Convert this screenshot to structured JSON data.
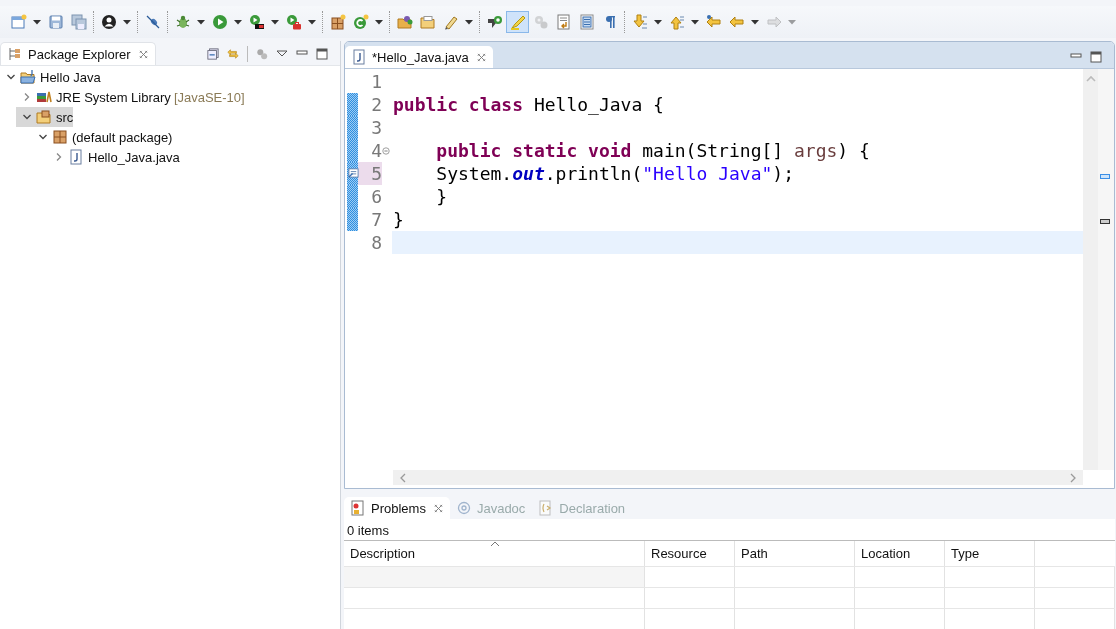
{
  "toolbar": {
    "groups": [
      {
        "items": [
          {
            "kind": "new",
            "dropdown": true,
            "selected": false,
            "disabled": false
          },
          {
            "kind": "save",
            "dropdown": false,
            "selected": false,
            "disabled": false
          },
          {
            "kind": "save-all",
            "dropdown": false,
            "selected": false,
            "disabled": false
          }
        ]
      },
      {
        "items": [
          {
            "kind": "person",
            "dropdown": true,
            "selected": false,
            "disabled": false
          }
        ]
      },
      {
        "items": [
          {
            "kind": "pin",
            "dropdown": false,
            "selected": false,
            "disabled": false
          }
        ]
      },
      {
        "items": [
          {
            "kind": "bug",
            "dropdown": true,
            "selected": false,
            "disabled": false
          },
          {
            "kind": "run",
            "dropdown": true,
            "selected": false,
            "disabled": false
          },
          {
            "kind": "coverage",
            "dropdown": true,
            "selected": false,
            "disabled": false
          },
          {
            "kind": "external",
            "dropdown": true,
            "selected": false,
            "disabled": false
          }
        ]
      },
      {
        "items": [
          {
            "kind": "new-package",
            "dropdown": false,
            "selected": false,
            "disabled": false
          },
          {
            "kind": "new-class",
            "dropdown": true,
            "selected": false,
            "disabled": false
          }
        ]
      },
      {
        "items": [
          {
            "kind": "open-type",
            "dropdown": false,
            "selected": false,
            "disabled": false
          },
          {
            "kind": "folder",
            "dropdown": false,
            "selected": false,
            "disabled": false
          },
          {
            "kind": "pencil",
            "dropdown": true,
            "selected": false,
            "disabled": false
          }
        ]
      },
      {
        "items": [
          {
            "kind": "declaration",
            "dropdown": false,
            "selected": false,
            "disabled": false
          },
          {
            "kind": "highlight",
            "dropdown": false,
            "selected": true,
            "disabled": false
          },
          {
            "kind": "gears",
            "dropdown": false,
            "selected": false,
            "disabled": true
          },
          {
            "kind": "document",
            "dropdown": false,
            "selected": false,
            "disabled": false
          },
          {
            "kind": "block",
            "dropdown": false,
            "selected": false,
            "disabled": false
          },
          {
            "kind": "pilcrow",
            "dropdown": false,
            "selected": false,
            "disabled": false
          }
        ]
      },
      {
        "items": [
          {
            "kind": "next",
            "dropdown": true,
            "selected": false,
            "disabled": false
          },
          {
            "kind": "previous",
            "dropdown": true,
            "selected": false,
            "disabled": false
          },
          {
            "kind": "last-edit",
            "dropdown": false,
            "selected": false,
            "disabled": false
          },
          {
            "kind": "back",
            "dropdown": true,
            "selected": false,
            "disabled": false
          },
          {
            "kind": "forward",
            "dropdown": true,
            "selected": false,
            "disabled": true
          }
        ]
      }
    ]
  },
  "explorer": {
    "title": "Package Explorer",
    "tree": [
      {
        "label": "Hello Java",
        "kind": "project",
        "expanded": true,
        "selected": false,
        "children": [
          {
            "label": "JRE System Library",
            "decoration": "[JavaSE-10]",
            "kind": "library",
            "expanded": false,
            "selected": false
          },
          {
            "label": "src",
            "kind": "source-folder",
            "expanded": true,
            "selected": true,
            "children": [
              {
                "label": "(default package)",
                "kind": "package",
                "expanded": true,
                "selected": false,
                "children": [
                  {
                    "label": "Hello_Java.java",
                    "kind": "java-file",
                    "expanded": false,
                    "selected": false
                  }
                ]
              }
            ]
          }
        ]
      }
    ]
  },
  "editor": {
    "tab": {
      "title": "*Hello_Java.java",
      "selected": true
    },
    "lines": [
      {
        "number": "1",
        "changed": false,
        "current": false,
        "fold": false,
        "task": false
      },
      {
        "number": "2",
        "changed": true,
        "current": false,
        "fold": false,
        "task": false,
        "tokens": [
          {
            "kind": "keyword",
            "text": "public class"
          },
          {
            "kind": "plain",
            "text": " Hello_Java {"
          }
        ]
      },
      {
        "number": "3",
        "changed": true,
        "current": false,
        "fold": false,
        "task": false
      },
      {
        "number": "4",
        "changed": true,
        "current": false,
        "fold": true,
        "task": false,
        "tokens": [
          {
            "kind": "keyword",
            "text": "    public static void"
          },
          {
            "kind": "plain",
            "text": " main(String[] "
          },
          {
            "kind": "parameter",
            "text": "args"
          },
          {
            "kind": "plain",
            "text": ") {"
          }
        ]
      },
      {
        "number": "5",
        "changed": true,
        "current": false,
        "fold": false,
        "task": true,
        "tokens": [
          {
            "kind": "plain",
            "text": "    System."
          },
          {
            "kind": "field",
            "text": "out"
          },
          {
            "kind": "plain",
            "text": ".println("
          },
          {
            "kind": "string",
            "text": "\"Hello Java\""
          },
          {
            "kind": "plain",
            "text": ");"
          }
        ]
      },
      {
        "number": "6",
        "changed": true,
        "current": false,
        "fold": false,
        "task": false,
        "tokens": [
          {
            "kind": "plain",
            "text": "    }"
          }
        ]
      },
      {
        "number": "7",
        "changed": true,
        "current": false,
        "fold": false,
        "task": false,
        "tokens": [
          {
            "kind": "plain",
            "text": "}"
          }
        ]
      },
      {
        "number": "8",
        "changed": false,
        "current": true,
        "fold": false,
        "task": false
      }
    ]
  },
  "bottom": {
    "tabs": [
      {
        "label": "Problems",
        "kind": "problems",
        "selected": true
      },
      {
        "label": "Javadoc",
        "kind": "at",
        "selected": false
      },
      {
        "label": "Declaration",
        "kind": "declaration",
        "selected": false
      }
    ],
    "summary": "0 items",
    "columns": [
      {
        "label": "Description",
        "sorted": true
      },
      {
        "label": "Resource",
        "sorted": false
      },
      {
        "label": "Path",
        "sorted": false
      },
      {
        "label": "Location",
        "sorted": false
      },
      {
        "label": "Type",
        "sorted": false
      }
    ]
  }
}
